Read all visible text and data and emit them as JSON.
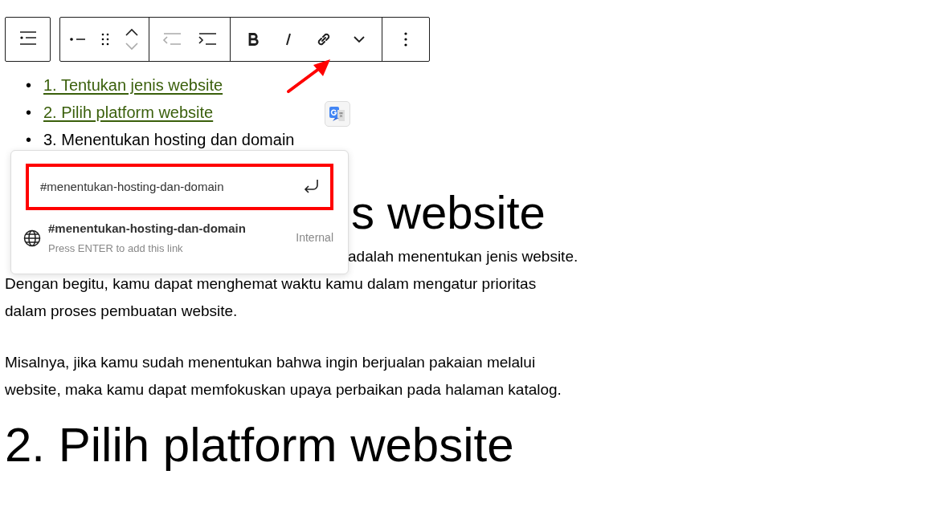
{
  "list": [
    {
      "bullet": "•",
      "text": "1. Tentukan jenis website",
      "link": true
    },
    {
      "bullet": "•",
      "text": "2. Pilih platform website",
      "link": true
    },
    {
      "bullet": "•",
      "text": "3. Menentukan hosting dan domain",
      "link": false
    }
  ],
  "link_popover": {
    "url_field": {
      "value": "#menentukan-hosting-dan-domain"
    },
    "suggestion": {
      "title": "#menentukan-hosting-dan-domain",
      "hint": "Press ENTER to add this link",
      "type_label": "Internal"
    }
  },
  "heading_1": "s website",
  "paragraphs": [
    {
      "covered_line": "adalah menentukan jenis website.",
      "lines": [
        "Dengan begitu, kamu dapat menghemat waktu kamu dalam mengatur prioritas",
        "dalam proses pembuatan website."
      ]
    },
    {
      "lines": [
        "Misalnya, jika kamu sudah menentukan bahwa ingin berjualan pakaian melalui",
        "website, maka kamu dapat memfokuskan upaya perbaikan pada halaman katalog."
      ]
    }
  ],
  "heading_2": "2. Pilih platform website"
}
